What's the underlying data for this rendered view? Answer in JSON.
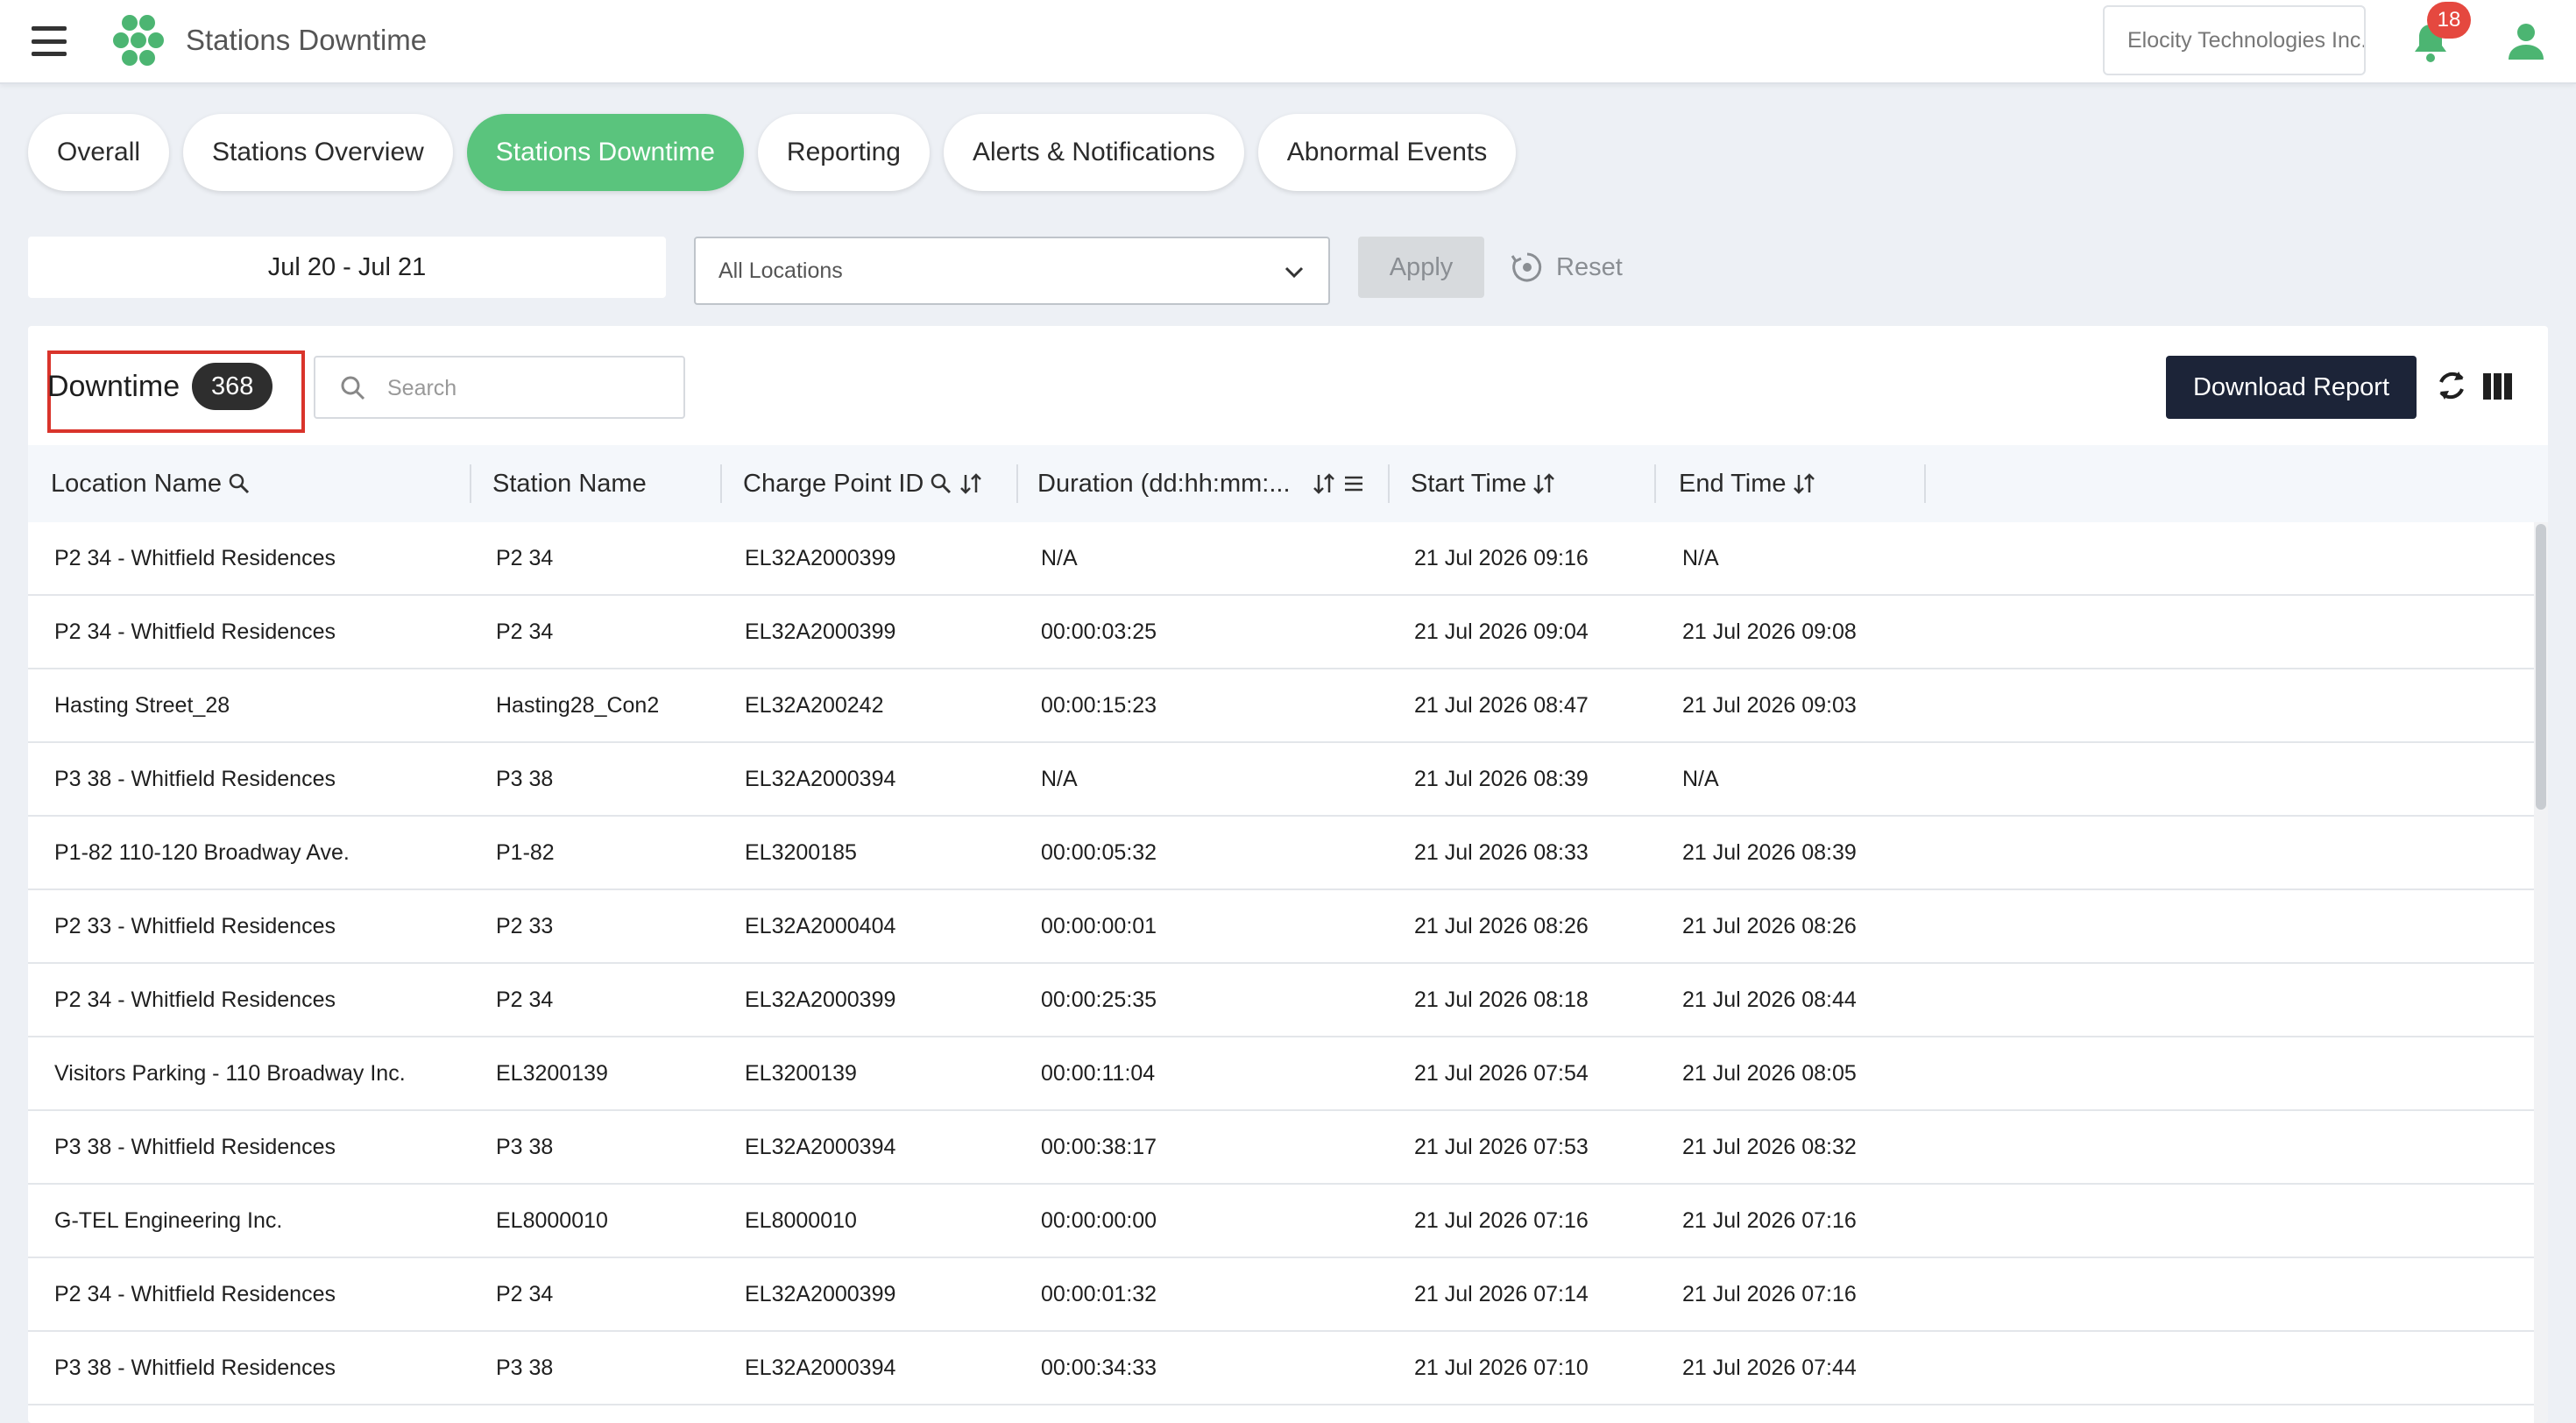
{
  "header": {
    "title": "Stations Downtime",
    "organization": "Elocity Technologies Inc.",
    "notification_count": "18",
    "icons": [
      "menu-icon",
      "hexagon-logo-icon",
      "bell-icon",
      "user-icon"
    ]
  },
  "tabs": [
    {
      "label": "Overall",
      "active": false
    },
    {
      "label": "Stations Overview",
      "active": false
    },
    {
      "label": "Stations Downtime",
      "active": true
    },
    {
      "label": "Reporting",
      "active": false
    },
    {
      "label": "Alerts & Notifications",
      "active": false
    },
    {
      "label": "Abnormal Events",
      "active": false
    }
  ],
  "filters": {
    "date_range": "Jul 20 - Jul 21",
    "location": "All Locations",
    "apply_label": "Apply",
    "reset_label": "Reset"
  },
  "downtime": {
    "title": "Downtime",
    "count": "368",
    "search_placeholder": "Search",
    "download_label": "Download Report"
  },
  "table": {
    "columns": [
      "Location Name",
      "Station Name",
      "Charge Point ID",
      "Duration (dd:hh:mm:...",
      "Start Time",
      "End Time"
    ],
    "rows": [
      [
        "P2 34 - Whitfield Residences",
        "P2 34",
        "EL32A2000399",
        "N/A",
        "21 Jul 2026 09:16",
        "N/A"
      ],
      [
        "P2 34 - Whitfield Residences",
        "P2 34",
        "EL32A2000399",
        "00:00:03:25",
        "21 Jul 2026 09:04",
        "21 Jul 2026 09:08"
      ],
      [
        "Hasting Street_28",
        "Hasting28_Con2",
        "EL32A200242",
        "00:00:15:23",
        "21 Jul 2026 08:47",
        "21 Jul 2026 09:03"
      ],
      [
        "P3 38 - Whitfield Residences",
        "P3 38",
        "EL32A2000394",
        "N/A",
        "21 Jul 2026 08:39",
        "N/A"
      ],
      [
        "P1-82 110-120 Broadway Ave.",
        "P1-82",
        "EL3200185",
        "00:00:05:32",
        "21 Jul 2026 08:33",
        "21 Jul 2026 08:39"
      ],
      [
        "P2 33 - Whitfield Residences",
        "P2 33",
        "EL32A2000404",
        "00:00:00:01",
        "21 Jul 2026 08:26",
        "21 Jul 2026 08:26"
      ],
      [
        "P2 34 - Whitfield Residences",
        "P2 34",
        "EL32A2000399",
        "00:00:25:35",
        "21 Jul 2026 08:18",
        "21 Jul 2026 08:44"
      ],
      [
        "Visitors Parking - 110 Broadway Inc.",
        "EL3200139",
        "EL3200139",
        "00:00:11:04",
        "21 Jul 2026 07:54",
        "21 Jul 2026 08:05"
      ],
      [
        "P3 38 - Whitfield Residences",
        "P3 38",
        "EL32A2000394",
        "00:00:38:17",
        "21 Jul 2026 07:53",
        "21 Jul 2026 08:32"
      ],
      [
        "G-TEL Engineering Inc.",
        "EL8000010",
        "EL8000010",
        "00:00:00:00",
        "21 Jul 2026 07:16",
        "21 Jul 2026 07:16"
      ],
      [
        "P2 34 - Whitfield Residences",
        "P2 34",
        "EL32A2000399",
        "00:00:01:32",
        "21 Jul 2026 07:14",
        "21 Jul 2026 07:16"
      ],
      [
        "P3 38 - Whitfield Residences",
        "P3 38",
        "EL32A2000394",
        "00:00:34:33",
        "21 Jul 2026 07:10",
        "21 Jul 2026 07:44"
      ]
    ]
  },
  "colors": {
    "accent": "#5ac47d",
    "primary_button": "#1c2438",
    "badge": "#e5483f",
    "highlight_border": "#d9342b"
  }
}
